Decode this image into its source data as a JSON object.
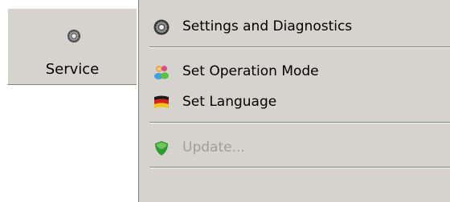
{
  "service_tab": {
    "label": "Service",
    "icon": "gear-icon"
  },
  "menu": {
    "items": [
      {
        "label": "Settings and Diagnostics",
        "icon": "gear-icon",
        "enabled": true
      },
      {
        "label": "Set Operation Mode",
        "icon": "users-icon",
        "enabled": true
      },
      {
        "label": "Set Language",
        "icon": "flag-icon",
        "enabled": true
      },
      {
        "label": "Update...",
        "icon": "shield-icon",
        "enabled": false
      }
    ]
  },
  "colors": {
    "panel": "#d6d3ce",
    "disabled_text": "#a19e98"
  }
}
